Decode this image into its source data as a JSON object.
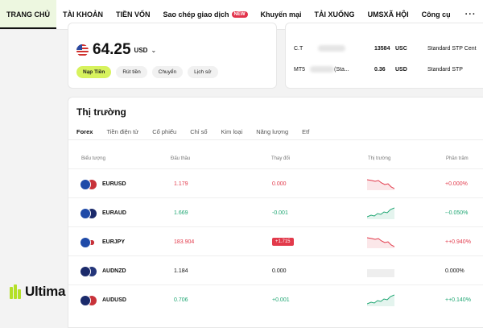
{
  "nav": {
    "items": [
      "TRANG CHỦ",
      "TÀI KHOẢN",
      "TIỀN VỐN",
      "Sao chép giao dịch",
      "Khuyến mại",
      "TẢI XUỐNG",
      "UMSXÃ HỘI",
      "Công cụ"
    ],
    "new_badge": "NEW",
    "more": "···"
  },
  "balance": {
    "amount": "64.25",
    "currency": "USD",
    "chevron": "⌄",
    "buttons": [
      "Nạp Tiền",
      "Rút tiền",
      "Chuyển",
      "Lịch sử"
    ]
  },
  "accounts": [
    {
      "id": "C.T",
      "tag": "",
      "balance": "13584",
      "currency": "USC",
      "type": "Standard STP Cent"
    },
    {
      "id": "MT5",
      "tag": "(Sta...",
      "balance": "0.36",
      "currency": "USD",
      "type": "Standard STP"
    }
  ],
  "market": {
    "title": "Thị trường",
    "tabs": [
      "Forex",
      "Tiền điện tử",
      "Cổ phiếu",
      "Chỉ số",
      "Kim loại",
      "Năng lượng",
      "Etf"
    ],
    "columns": {
      "symbol": "Biểu tượng",
      "price": "Đấu thầu",
      "change": "Thay đổi",
      "trend": "Thị trường",
      "percent": "Phần trăm"
    },
    "rows": [
      {
        "symbol": "EURUSD",
        "price": "1.179",
        "change": "0.000",
        "percent": "+0.000%",
        "trend": "down",
        "color": "#e23a4b"
      },
      {
        "symbol": "EURAUD",
        "price": "1.669",
        "change": "-0.001",
        "percent": "--0.050%",
        "trend": "up",
        "color": "#1ea672"
      },
      {
        "symbol": "EURJPY",
        "price": "183.904",
        "change": "+1.715",
        "percent": "++0.940%",
        "trend": "down",
        "color": "#e23a4b"
      },
      {
        "symbol": "AUDNZD",
        "price": "1.184",
        "change": "0.000",
        "percent": "0.000%",
        "trend": "flat",
        "color": "#111111"
      },
      {
        "symbol": "AUDUSD",
        "price": "0.706",
        "change": "+0.001",
        "percent": "++0.140%",
        "trend": "up",
        "color": "#1ea672"
      }
    ]
  },
  "logo": {
    "text": "Ultima"
  },
  "colors": {
    "accent": "#d7f25d",
    "up": "#1ea672",
    "down": "#e23a4b",
    "brand": "#b4e028"
  }
}
